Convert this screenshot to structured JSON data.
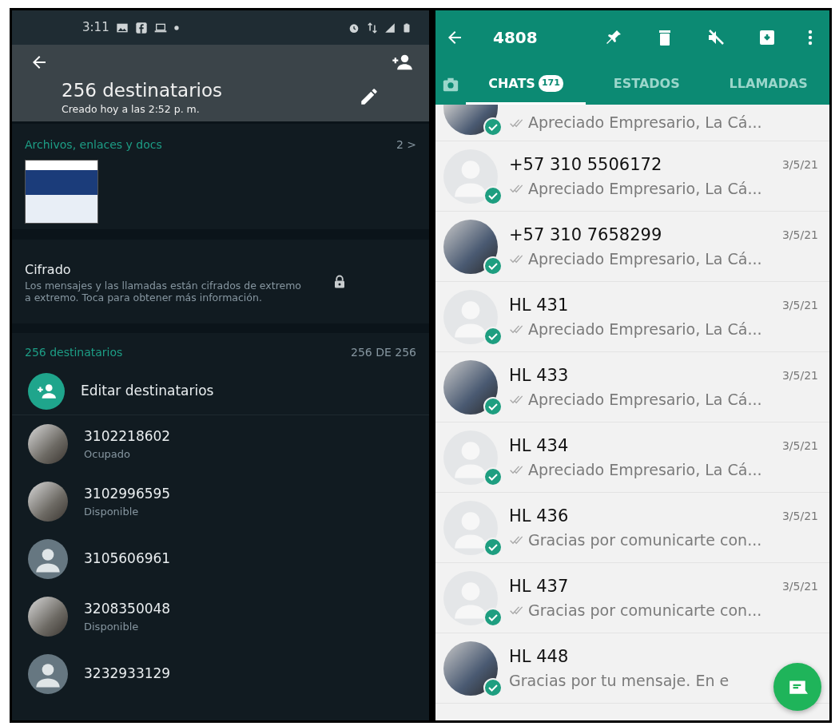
{
  "left_screen": {
    "status_bar": {
      "time": "3:11"
    },
    "header": {
      "title": "256 destinatarios",
      "subtitle": "Creado hoy a las 2:52 p. m."
    },
    "media": {
      "title": "Archivos, enlaces y docs",
      "count": "2",
      "chevron": ">"
    },
    "encryption": {
      "title": "Cifrado",
      "text": "Los mensajes y las llamadas están cifrados de extremo a extremo. Toca para obtener más información."
    },
    "recipients": {
      "title": "256 destinatarios",
      "count": "256 DE 256",
      "items": [
        {
          "kind": "action",
          "name": "Editar destinatarios"
        },
        {
          "kind": "contact",
          "has_photo": true,
          "name": "3102218602",
          "status": "Ocupado"
        },
        {
          "kind": "contact",
          "has_photo": true,
          "name": "3102996595",
          "status": "Disponible"
        },
        {
          "kind": "contact",
          "has_photo": false,
          "name": "3105606961"
        },
        {
          "kind": "contact",
          "has_photo": true,
          "name": "3208350048",
          "status": "Disponible"
        },
        {
          "kind": "contact",
          "has_photo": false,
          "name": "3232933129"
        }
      ]
    }
  },
  "right_screen": {
    "app_bar": {
      "title": "4808"
    },
    "tabs": [
      {
        "label": "CHATS",
        "badge": "171",
        "selected": true
      },
      {
        "label": "ESTADOS",
        "selected": false
      },
      {
        "label": "LLAMADAS",
        "selected": false
      }
    ],
    "chats": [
      {
        "partial": true,
        "has_photo": true,
        "selected": true,
        "read_ticks": true,
        "preview": "Apreciado Empresario, La Cá..."
      },
      {
        "partial": false,
        "has_photo": false,
        "selected": true,
        "read_ticks": true,
        "name": "+57 310 5506172",
        "date": "3/5/21",
        "preview": "Apreciado Empresario, La Cá..."
      },
      {
        "partial": false,
        "has_photo": true,
        "selected": true,
        "read_ticks": true,
        "name": "+57 310 7658299",
        "date": "3/5/21",
        "preview": "Apreciado Empresario, La Cá..."
      },
      {
        "partial": false,
        "has_photo": false,
        "selected": true,
        "read_ticks": true,
        "name": "HL  431",
        "date": "3/5/21",
        "preview": "Apreciado Empresario, La Cá..."
      },
      {
        "partial": false,
        "has_photo": true,
        "selected": true,
        "read_ticks": true,
        "name": "HL  433",
        "date": "3/5/21",
        "preview": "Apreciado Empresario, La Cá..."
      },
      {
        "partial": false,
        "has_photo": false,
        "selected": true,
        "read_ticks": true,
        "name": "HL  434",
        "date": "3/5/21",
        "preview": "Apreciado Empresario, La Cá..."
      },
      {
        "partial": false,
        "has_photo": false,
        "selected": true,
        "read_ticks": true,
        "name": "HL  436",
        "date": "3/5/21",
        "preview": "Gracias por comunicarte con..."
      },
      {
        "partial": false,
        "has_photo": false,
        "selected": true,
        "read_ticks": true,
        "name": "HL  437",
        "date": "3/5/21",
        "preview": "Gracias por comunicarte con..."
      },
      {
        "partial": false,
        "has_photo": true,
        "selected": true,
        "read_ticks": false,
        "name": "HL  448",
        "preview": "Gracias por tu mensaje. En e"
      }
    ]
  }
}
